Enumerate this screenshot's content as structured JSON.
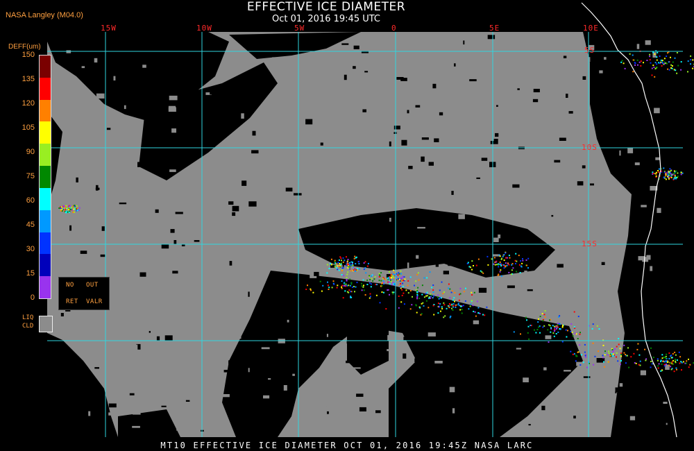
{
  "header": {
    "title": "EFFECTIVE ICE DIAMETER",
    "subtitle": "Oct 01, 2016 19:45 UTC",
    "credit": "NASA Langley (M04.0)"
  },
  "map": {
    "longitude_labels": [
      "15W",
      "10W",
      "5W",
      "0",
      "5E",
      "10E"
    ],
    "latitude_labels": [
      "5S",
      "10S",
      "15S"
    ],
    "colors": {
      "gridline": "#2fd6e0",
      "liquid_cloud": "#8c8c8c",
      "background": "#000000",
      "coastline": "#ffffff",
      "label": "#ff2a2a"
    }
  },
  "legend": {
    "unit_label": "DEFF(um)",
    "ticks": [
      "150",
      "135",
      "120",
      "105",
      "90",
      "75",
      "60",
      "45",
      "30",
      "15",
      "0"
    ],
    "color_steps": [
      "#7a0000",
      "#ff0000",
      "#ff8000",
      "#ffff00",
      "#99ee22",
      "#008800",
      "#00ffff",
      "#0099ff",
      "#0033ff",
      "#0000bb",
      "#9933ee"
    ],
    "no_retrieval": {
      "line1_a": "NO",
      "line1_b": "OUT",
      "line2_a": "RET",
      "line2_b": "VALR"
    },
    "liquid_cloud": {
      "line1": "LIQ",
      "line2": "CLD"
    }
  },
  "footer": {
    "text": "MT10  EFFECTIVE ICE DIAMETER  OCT 01, 2016 19:45Z  NASA LARC"
  }
}
